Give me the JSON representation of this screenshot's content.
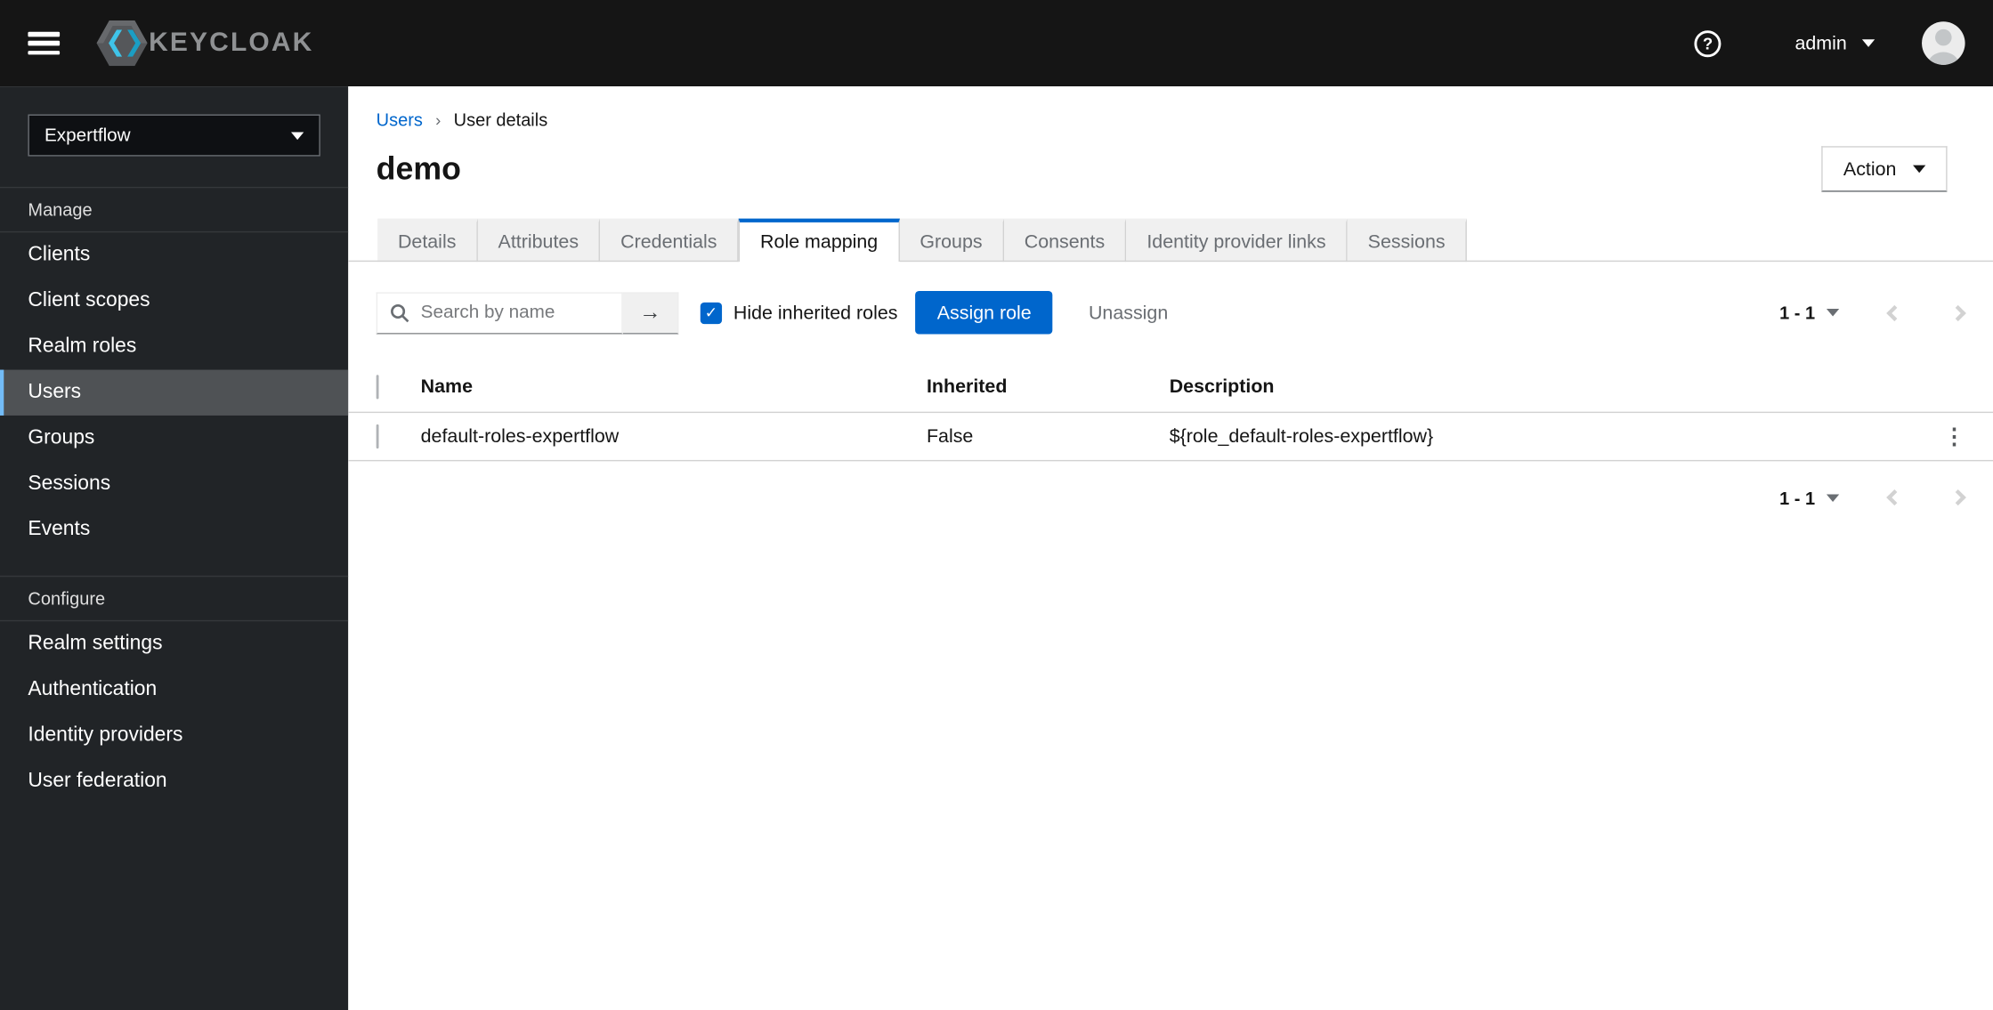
{
  "topbar": {
    "brand": "KEYCLOAK",
    "username": "admin"
  },
  "sidebar": {
    "realm": "Expertflow",
    "sections": [
      {
        "title": "Manage",
        "items": [
          "Clients",
          "Client scopes",
          "Realm roles",
          "Users",
          "Groups",
          "Sessions",
          "Events"
        ]
      },
      {
        "title": "Configure",
        "items": [
          "Realm settings",
          "Authentication",
          "Identity providers",
          "User federation"
        ]
      }
    ],
    "selected_item": "Users"
  },
  "breadcrumb": {
    "parent": "Users",
    "current": "User details"
  },
  "header": {
    "title": "demo",
    "action_label": "Action"
  },
  "tabs": {
    "items": [
      "Details",
      "Attributes",
      "Credentials",
      "Role mapping",
      "Groups",
      "Consents",
      "Identity provider links",
      "Sessions"
    ],
    "active": "Role mapping"
  },
  "toolbar": {
    "search_placeholder": "Search by name",
    "hide_inherited_label": "Hide inherited roles",
    "hide_inherited_checked": true,
    "assign_button": "Assign role",
    "unassign_button": "Unassign",
    "pagination_range": "1 - 1"
  },
  "table": {
    "columns": [
      "Name",
      "Inherited",
      "Description"
    ],
    "rows": [
      {
        "name": "default-roles-expertflow",
        "inherited": "False",
        "description": "${role_default-roles-expertflow}"
      }
    ]
  },
  "footer": {
    "pagination_range": "1 - 1"
  },
  "colors": {
    "accent": "#0066cc",
    "nav_selected_border": "#73bcf7",
    "topbar_bg": "#151515",
    "sidebar_bg": "#212427"
  }
}
